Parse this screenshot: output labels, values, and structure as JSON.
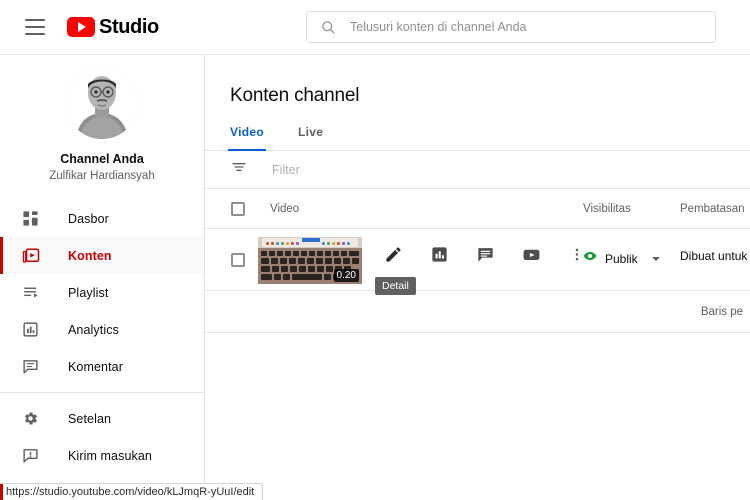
{
  "topbar": {
    "menu_icon": "hamburger-icon",
    "brand": "Studio",
    "logo_icon": "youtube-play-icon",
    "search": {
      "icon": "search-icon",
      "placeholder": "Telusuri konten di channel Anda",
      "value": ""
    }
  },
  "sidebar": {
    "channel": {
      "avatar_icon": "user-avatar-photo",
      "title": "Channel Anda",
      "name": "Zulfikar Hardiansyah"
    },
    "items": [
      {
        "label": "Dasbor",
        "icon": "dashboard-icon",
        "active": false
      },
      {
        "label": "Konten",
        "icon": "content-icon",
        "active": true
      },
      {
        "label": "Playlist",
        "icon": "playlist-icon",
        "active": false
      },
      {
        "label": "Analytics",
        "icon": "analytics-icon",
        "active": false
      },
      {
        "label": "Komentar",
        "icon": "comment-icon",
        "active": false
      }
    ],
    "bottom_items": [
      {
        "label": "Setelan",
        "icon": "gear-icon"
      },
      {
        "label": "Kirim masukan",
        "icon": "feedback-icon"
      }
    ]
  },
  "main": {
    "page_title": "Konten channel",
    "tabs": [
      {
        "label": "Video",
        "active": true
      },
      {
        "label": "Live",
        "active": false
      }
    ],
    "filter": {
      "icon": "filter-icon",
      "placeholder": "Filter"
    },
    "table": {
      "columns": {
        "video": "Video",
        "visibility": "Visibilitas",
        "restrictions": "Pembatasan"
      },
      "rows": [
        {
          "checkbox_checked": false,
          "thumbnail_icon": "laptop-keyboard-thumbnail",
          "duration": "0.20",
          "visibility": "Publik",
          "visibility_icon": "eye-icon",
          "visibility_color": "#1a9e3c",
          "restrictions": "Dibuat untuk A"
        }
      ],
      "row_actions": [
        {
          "label": "Detail",
          "icon": "pencil-icon"
        },
        {
          "label": "Analytics",
          "icon": "bar-chart-icon"
        },
        {
          "label": "Komentar",
          "icon": "comment-box-icon"
        },
        {
          "label": "Lihat di YouTube",
          "icon": "youtube-play-icon"
        },
        {
          "label": "Opsi",
          "icon": "more-vert-icon"
        }
      ],
      "tooltip": "Detail",
      "footer_label": "Baris pe"
    }
  },
  "statusbar": {
    "url": "https://studio.youtube.com/video/kLJmqR-yUuI/edit"
  },
  "colors": {
    "brand_red": "#ff0000",
    "active_red": "#cc0000",
    "tab_blue": "#065fd4",
    "public_green": "#1a9e3c",
    "border": "#e5e5e5"
  }
}
